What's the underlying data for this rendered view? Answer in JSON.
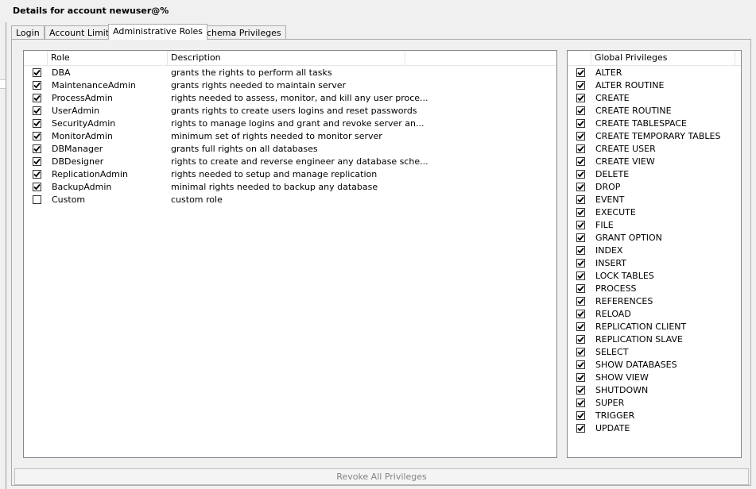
{
  "title": "Details for account newuser@%",
  "tabs": [
    {
      "label": "Login",
      "active": false
    },
    {
      "label": "Account Limits",
      "active": false
    },
    {
      "label": "Administrative Roles",
      "active": true
    },
    {
      "label": "Schema Privileges",
      "active": false
    }
  ],
  "roles_table": {
    "headers": {
      "role": "Role",
      "description": "Description"
    },
    "rows": [
      {
        "checked": true,
        "role": "DBA",
        "description": "grants the rights to perform all tasks"
      },
      {
        "checked": true,
        "role": "MaintenanceAdmin",
        "description": "grants rights needed to maintain server"
      },
      {
        "checked": true,
        "role": "ProcessAdmin",
        "description": "rights needed to assess, monitor, and kill any user proce..."
      },
      {
        "checked": true,
        "role": "UserAdmin",
        "description": "grants rights to create users logins and reset passwords"
      },
      {
        "checked": true,
        "role": "SecurityAdmin",
        "description": "rights to manage logins and grant and revoke server an..."
      },
      {
        "checked": true,
        "role": "MonitorAdmin",
        "description": "minimum set of rights needed to monitor server"
      },
      {
        "checked": true,
        "role": "DBManager",
        "description": "grants full rights on all databases"
      },
      {
        "checked": true,
        "role": "DBDesigner",
        "description": "rights to create and reverse engineer any database sche..."
      },
      {
        "checked": true,
        "role": "ReplicationAdmin",
        "description": "rights needed to setup and manage replication"
      },
      {
        "checked": true,
        "role": "BackupAdmin",
        "description": "minimal rights needed to backup any database"
      },
      {
        "checked": false,
        "role": "Custom",
        "description": "custom role"
      }
    ]
  },
  "global_privileges": {
    "header": "Global Privileges",
    "items": [
      {
        "checked": true,
        "label": "ALTER"
      },
      {
        "checked": true,
        "label": "ALTER ROUTINE"
      },
      {
        "checked": true,
        "label": "CREATE"
      },
      {
        "checked": true,
        "label": "CREATE ROUTINE"
      },
      {
        "checked": true,
        "label": "CREATE TABLESPACE"
      },
      {
        "checked": true,
        "label": "CREATE TEMPORARY TABLES"
      },
      {
        "checked": true,
        "label": "CREATE USER"
      },
      {
        "checked": true,
        "label": "CREATE VIEW"
      },
      {
        "checked": true,
        "label": "DELETE"
      },
      {
        "checked": true,
        "label": "DROP"
      },
      {
        "checked": true,
        "label": "EVENT"
      },
      {
        "checked": true,
        "label": "EXECUTE"
      },
      {
        "checked": true,
        "label": "FILE"
      },
      {
        "checked": true,
        "label": "GRANT OPTION"
      },
      {
        "checked": true,
        "label": "INDEX"
      },
      {
        "checked": true,
        "label": "INSERT"
      },
      {
        "checked": true,
        "label": "LOCK TABLES"
      },
      {
        "checked": true,
        "label": "PROCESS"
      },
      {
        "checked": true,
        "label": "REFERENCES"
      },
      {
        "checked": true,
        "label": "RELOAD"
      },
      {
        "checked": true,
        "label": "REPLICATION CLIENT"
      },
      {
        "checked": true,
        "label": "REPLICATION SLAVE"
      },
      {
        "checked": true,
        "label": "SELECT"
      },
      {
        "checked": true,
        "label": "SHOW DATABASES"
      },
      {
        "checked": true,
        "label": "SHOW VIEW"
      },
      {
        "checked": true,
        "label": "SHUTDOWN"
      },
      {
        "checked": true,
        "label": "SUPER"
      },
      {
        "checked": true,
        "label": "TRIGGER"
      },
      {
        "checked": true,
        "label": "UPDATE"
      }
    ]
  },
  "revoke_button": {
    "label": "Revoke All Privileges",
    "enabled": false
  }
}
